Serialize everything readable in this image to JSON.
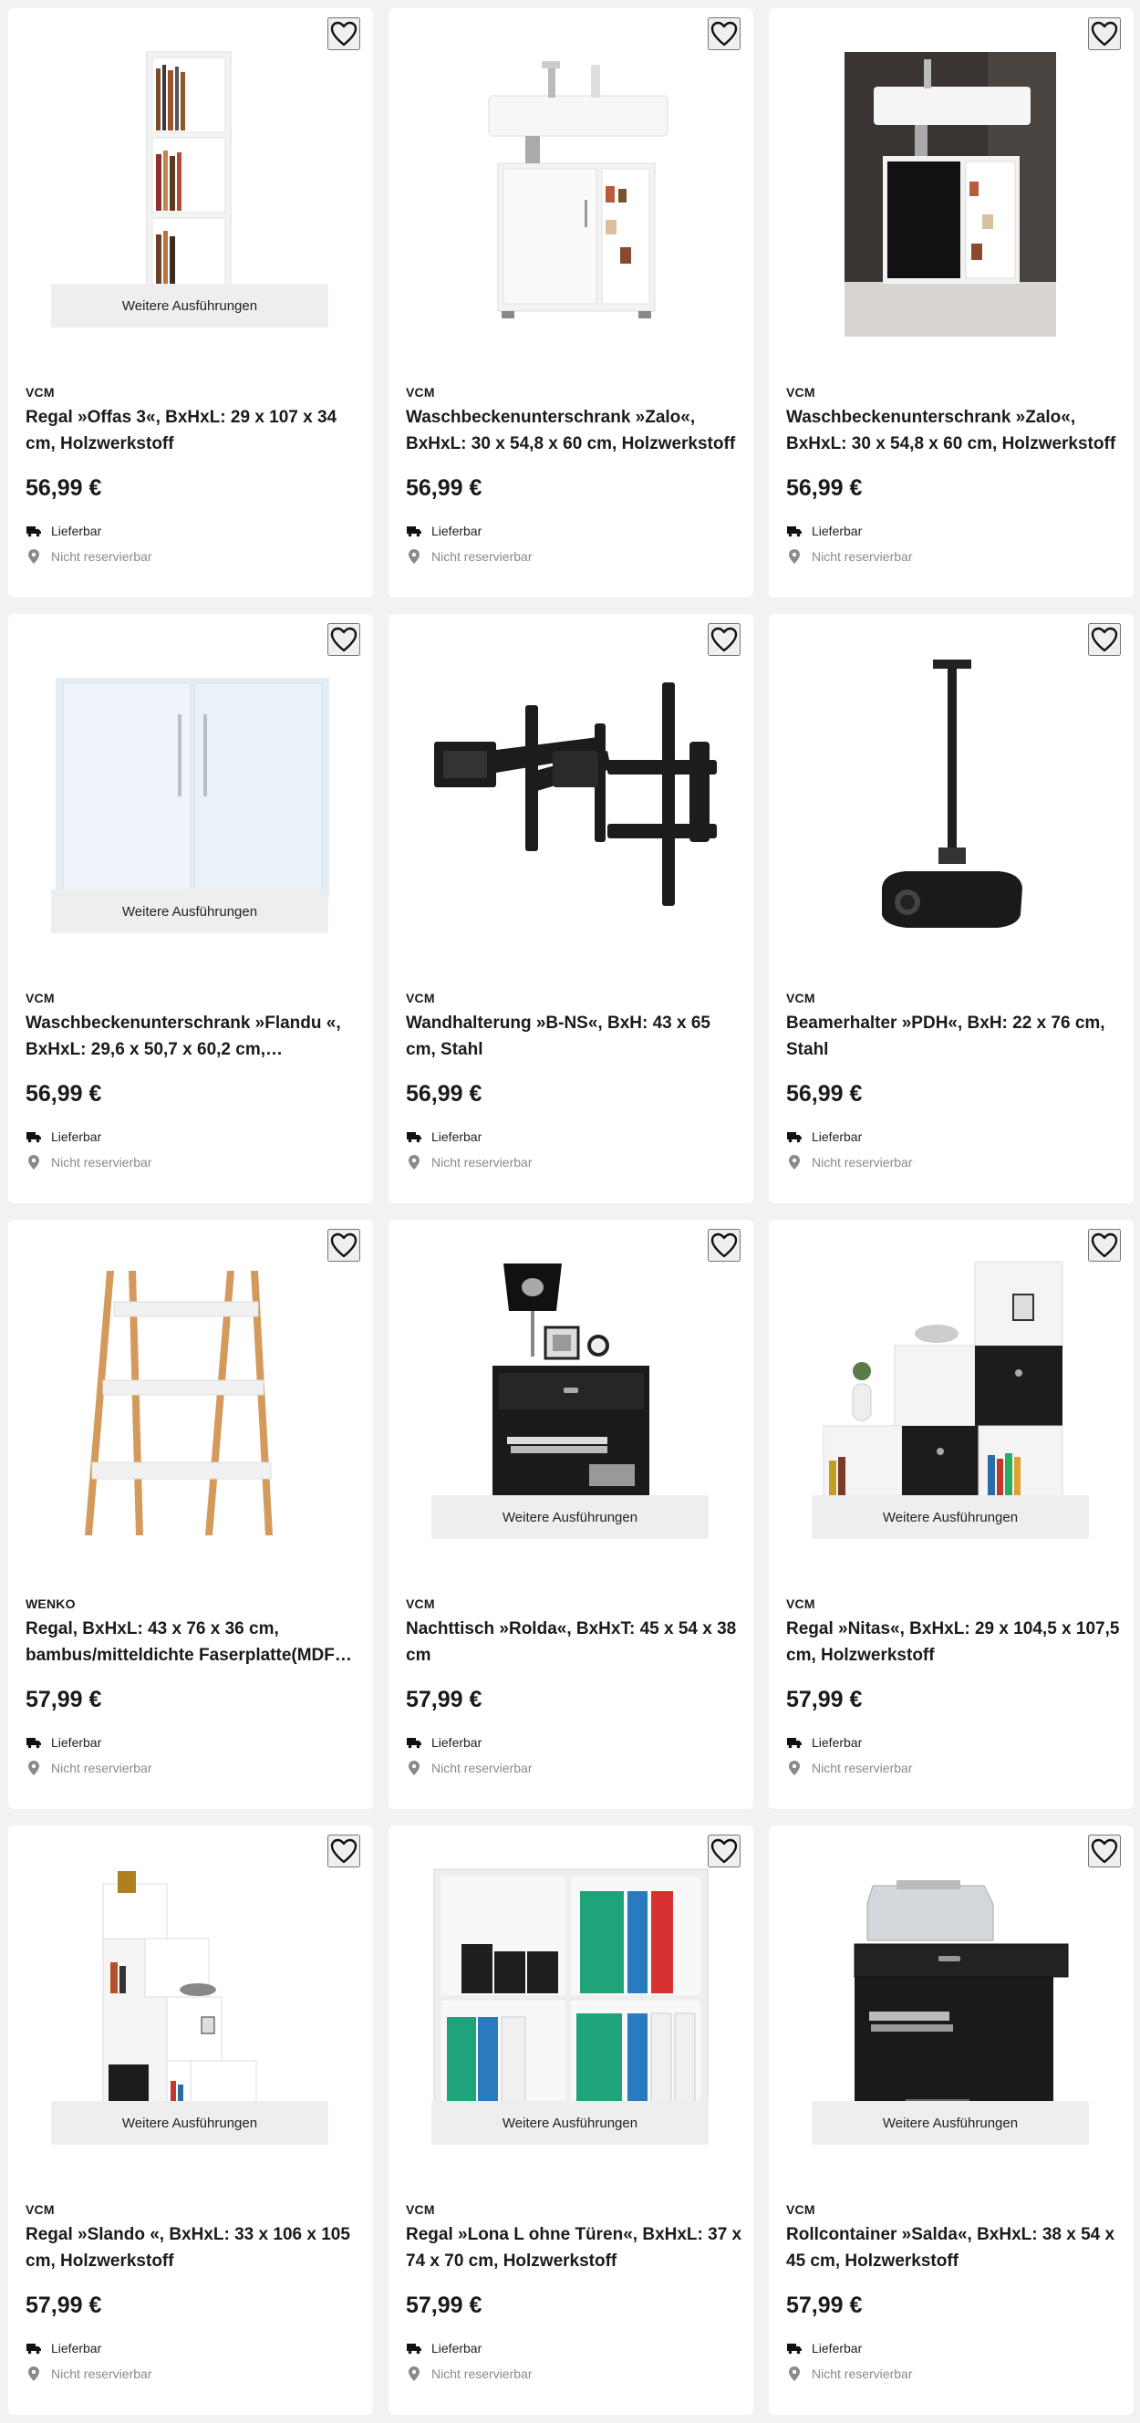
{
  "labels": {
    "variants": "Weitere Ausführungen",
    "delivery": "Lieferbar",
    "store": "Nicht reservierbar"
  },
  "products": [
    {
      "brand": "VCM",
      "title": "Regal »Offas 3«, BxHxL: 29 x 107 x 34 cm, Holzwerkstoff",
      "price": "56,99 €",
      "has_variants": true,
      "icon": "shelf-tall-image"
    },
    {
      "brand": "VCM",
      "title": "Waschbeckenunterschrank »Zalo«, BxHxL: 30 x 54,8 x 60 cm, Holzwerkstoff",
      "price": "56,99 €",
      "has_variants": false,
      "icon": "sink-cabinet-white-image"
    },
    {
      "brand": "VCM",
      "title": "Waschbeckenunterschrank »Zalo«, BxHxL: 30 x 54,8 x 60 cm, Holzwerkstoff",
      "price": "56,99 €",
      "has_variants": false,
      "icon": "sink-cabinet-black-image"
    },
    {
      "brand": "VCM",
      "title": "Waschbeckenunterschrank »Flandu «, BxHxL: 29,6 x 50,7 x 60,2 cm,…",
      "price": "56,99 €",
      "has_variants": true,
      "icon": "cabinet-white-image"
    },
    {
      "brand": "VCM",
      "title": "Wandhalterung »B-NS«, BxH: 43 x 65 cm, Stahl",
      "price": "56,99 €",
      "has_variants": false,
      "icon": "tv-mount-image"
    },
    {
      "brand": "VCM",
      "title": "Beamerhalter »PDH«, BxH: 22 x 76 cm, Stahl",
      "price": "56,99 €",
      "has_variants": false,
      "icon": "projector-mount-image"
    },
    {
      "brand": "WENKO",
      "title": "Regal, BxHxL: 43 x 76 x 36 cm, bambus/mitteldichte Faserplatte(MDF…",
      "price": "57,99 €",
      "has_variants": false,
      "icon": "bamboo-shelf-image"
    },
    {
      "brand": "VCM",
      "title": "Nachttisch »Rolda«, BxHxT: 45 x 54 x 38 cm",
      "price": "57,99 €",
      "has_variants": true,
      "icon": "nightstand-image"
    },
    {
      "brand": "VCM",
      "title": "Regal »Nitas«, BxHxL: 29 x 104,5 x 107,5 cm, Holzwerkstoff",
      "price": "57,99 €",
      "has_variants": true,
      "icon": "cube-shelf-image"
    },
    {
      "brand": "VCM",
      "title": "Regal »Slando «, BxHxL: 33 x 106 x 105 cm, Holzwerkstoff",
      "price": "57,99 €",
      "has_variants": true,
      "icon": "step-shelf-image"
    },
    {
      "brand": "VCM",
      "title": "Regal »Lona L ohne Türen«, BxHxL: 37 x 74 x 70 cm, Holzwerkstoff",
      "price": "57,99 €",
      "has_variants": true,
      "icon": "office-shelf-image"
    },
    {
      "brand": "VCM",
      "title": "Rollcontainer »Salda«, BxHxL: 38 x 54 x 45 cm, Holzwerkstoff",
      "price": "57,99 €",
      "has_variants": true,
      "icon": "printer-cart-image"
    }
  ]
}
